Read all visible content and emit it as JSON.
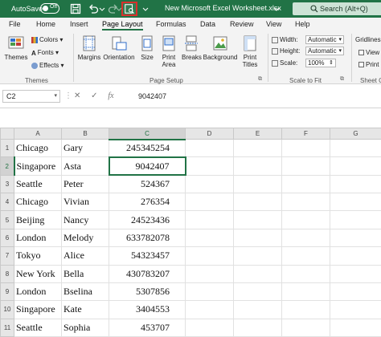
{
  "titlebar": {
    "autosave_label": "AutoSave",
    "autosave_state": "Off",
    "document_title": "New Microsoft Excel Worksheet.xlsx",
    "search_placeholder": "Search (Alt+Q)",
    "icons": [
      "save-icon",
      "undo-icon",
      "redo-icon",
      "print-preview-icon"
    ]
  },
  "menu": {
    "tabs": [
      "File",
      "Home",
      "Insert",
      "Page Layout",
      "Formulas",
      "Data",
      "Review",
      "View",
      "Help"
    ],
    "active": "Page Layout"
  },
  "ribbon": {
    "themes": {
      "themes_label": "Themes",
      "colors_label": "Colors",
      "fonts_label": "Fonts",
      "effects_label": "Effects",
      "group_label": "Themes"
    },
    "page_setup": {
      "margins": "Margins",
      "orientation": "Orientation",
      "size": "Size",
      "print_area_1": "Print",
      "print_area_2": "Area",
      "breaks": "Breaks",
      "background": "Background",
      "print_titles_1": "Print",
      "print_titles_2": "Titles",
      "group_label": "Page Setup"
    },
    "scale_to_fit": {
      "width_label": "Width:",
      "width_value": "Automatic",
      "height_label": "Height:",
      "height_value": "Automatic",
      "scale_label": "Scale:",
      "scale_value": "100%",
      "group_label": "Scale to Fit"
    },
    "sheet_options": {
      "gridlines_label": "Gridlines",
      "view_label": "View",
      "print_label": "Print",
      "group_label": "Sheet Op"
    }
  },
  "formula_bar": {
    "name_box": "C2",
    "cancel_glyph": "✕",
    "enter_glyph": "✓",
    "fx_label": "fx",
    "value": "9042407"
  },
  "grid": {
    "columns": [
      "A",
      "B",
      "C",
      "D",
      "E",
      "F",
      "G"
    ],
    "selected_column": "C",
    "selected_row": "2",
    "rows": [
      {
        "num": "1",
        "a": "Chicago",
        "b": "Gary",
        "c": "245345254"
      },
      {
        "num": "2",
        "a": "Singapore",
        "b": "Asta",
        "c": "9042407"
      },
      {
        "num": "3",
        "a": "Seattle",
        "b": "Peter",
        "c": "524367"
      },
      {
        "num": "4",
        "a": "Chicago",
        "b": "Vivian",
        "c": "276354"
      },
      {
        "num": "5",
        "a": "Beijing",
        "b": "Nancy",
        "c": "24523436"
      },
      {
        "num": "6",
        "a": "London",
        "b": "Melody",
        "c": "633782078"
      },
      {
        "num": "7",
        "a": "Tokyo",
        "b": "Alice",
        "c": "54323457"
      },
      {
        "num": "8",
        "a": "New York",
        "b": "Bella",
        "c": "430783207"
      },
      {
        "num": "9",
        "a": "London",
        "b": "Bselina",
        "c": "5307856"
      },
      {
        "num": "10",
        "a": "Singapore",
        "b": "Kate",
        "c": "3404553"
      },
      {
        "num": "11",
        "a": "Seattle",
        "b": "Sophia",
        "c": "453707"
      }
    ]
  },
  "colors": {
    "accent": "#217346",
    "highlight_box": "#d9302c"
  }
}
